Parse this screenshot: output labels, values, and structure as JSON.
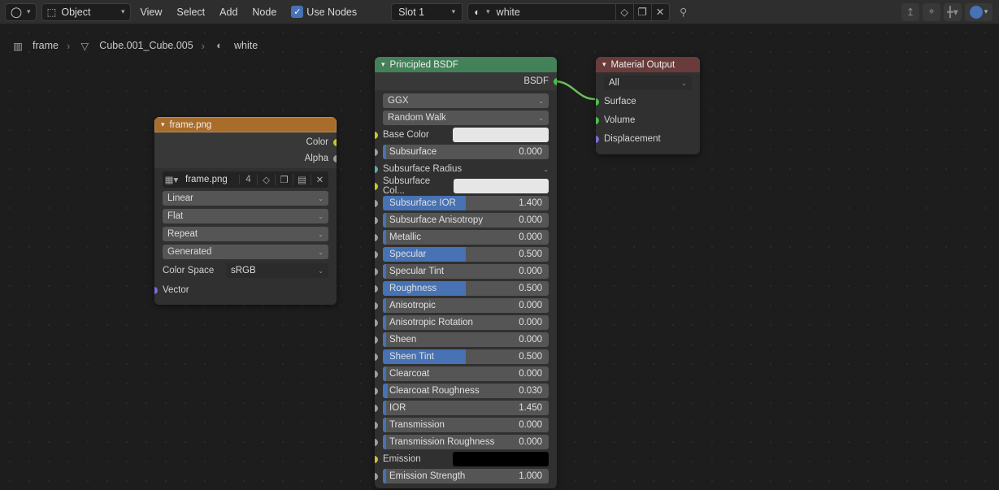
{
  "header": {
    "mode": "Object",
    "menus": [
      "View",
      "Select",
      "Add",
      "Node"
    ],
    "use_nodes": "Use Nodes",
    "slot": "Slot 1",
    "material": "white"
  },
  "breadcrumb": {
    "a": "frame",
    "b": "Cube.001_Cube.005",
    "c": "white"
  },
  "img_node": {
    "title": "frame.png",
    "out_color": "Color",
    "out_alpha": "Alpha",
    "filename": "frame.png",
    "users": "4",
    "interp": "Linear",
    "proj": "Flat",
    "ext": "Repeat",
    "src": "Generated",
    "cs_label": "Color Space",
    "cs_value": "sRGB",
    "vector": "Vector"
  },
  "p": {
    "title": "Principled BSDF",
    "out": "BSDF",
    "distribution": "GGX",
    "sss_method": "Random Walk",
    "base_color": "Base Color",
    "sss_radius": "Subsurface Radius",
    "sss_color": "Subsurface Col...",
    "emission": "Emission",
    "sliders": {
      "subsurface": {
        "l": "Subsurface",
        "v": "0.000",
        "f": 0.02
      },
      "subsurface_ior": {
        "l": "Subsurface IOR",
        "v": "1.400",
        "f": 0.5
      },
      "subsurface_aniso": {
        "l": "Subsurface Anisotropy",
        "v": "0.000",
        "f": 0.02
      },
      "metallic": {
        "l": "Metallic",
        "v": "0.000",
        "f": 0.02
      },
      "specular": {
        "l": "Specular",
        "v": "0.500",
        "f": 0.5
      },
      "specular_tint": {
        "l": "Specular Tint",
        "v": "0.000",
        "f": 0.02
      },
      "roughness": {
        "l": "Roughness",
        "v": "0.500",
        "f": 0.5
      },
      "anisotropic": {
        "l": "Anisotropic",
        "v": "0.000",
        "f": 0.02
      },
      "anisotropic_rot": {
        "l": "Anisotropic Rotation",
        "v": "0.000",
        "f": 0.02
      },
      "sheen": {
        "l": "Sheen",
        "v": "0.000",
        "f": 0.02
      },
      "sheen_tint": {
        "l": "Sheen Tint",
        "v": "0.500",
        "f": 0.5
      },
      "clearcoat": {
        "l": "Clearcoat",
        "v": "0.000",
        "f": 0.02
      },
      "clearcoat_roughness": {
        "l": "Clearcoat Roughness",
        "v": "0.030",
        "f": 0.03
      },
      "ior": {
        "l": "IOR",
        "v": "1.450",
        "f": 0.02
      },
      "transmission": {
        "l": "Transmission",
        "v": "0.000",
        "f": 0.02
      },
      "transmission_roughness": {
        "l": "Transmission Roughness",
        "v": "0.000",
        "f": 0.02
      },
      "emission_strength": {
        "l": "Emission Strength",
        "v": "1.000",
        "f": 0.02
      }
    }
  },
  "o": {
    "title": "Material Output",
    "target": "All",
    "surface": "Surface",
    "volume": "Volume",
    "displacement": "Displacement"
  }
}
